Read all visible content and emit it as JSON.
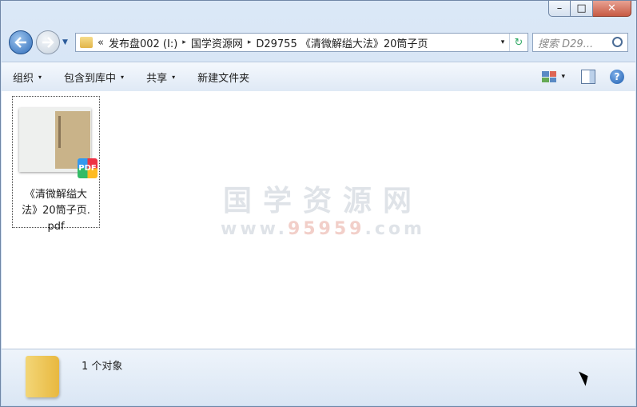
{
  "window_controls": {
    "minimize": "–",
    "maximize": "□",
    "close": "✕"
  },
  "nav": {
    "history_chevron": "«",
    "breadcrumbs": [
      "发布盘002 (I:)",
      "国学资源网",
      "D29755 《清微解缢大法》20筒子页"
    ],
    "separator": "▸",
    "dropdown": "▾",
    "refresh": "↻",
    "search_placeholder": "搜索 D29..."
  },
  "toolbar": {
    "items": [
      {
        "label": "组织",
        "arrow": "▾"
      },
      {
        "label": "包含到库中",
        "arrow": "▾"
      },
      {
        "label": "共享",
        "arrow": "▾"
      },
      {
        "label": "新建文件夹",
        "arrow": ""
      }
    ],
    "view_arrow": "▾",
    "help": "?"
  },
  "content": {
    "file": {
      "name_line1": "《清微解缢大",
      "name_line2": "法》20筒子页.",
      "name_line3": "pdf",
      "badge": "PDF"
    },
    "watermark": {
      "line1": "国学资源网",
      "line2_prefix": "www.",
      "line2_number": "95959",
      "line2_suffix": ".com"
    }
  },
  "status": {
    "count_text": "1 个对象"
  }
}
